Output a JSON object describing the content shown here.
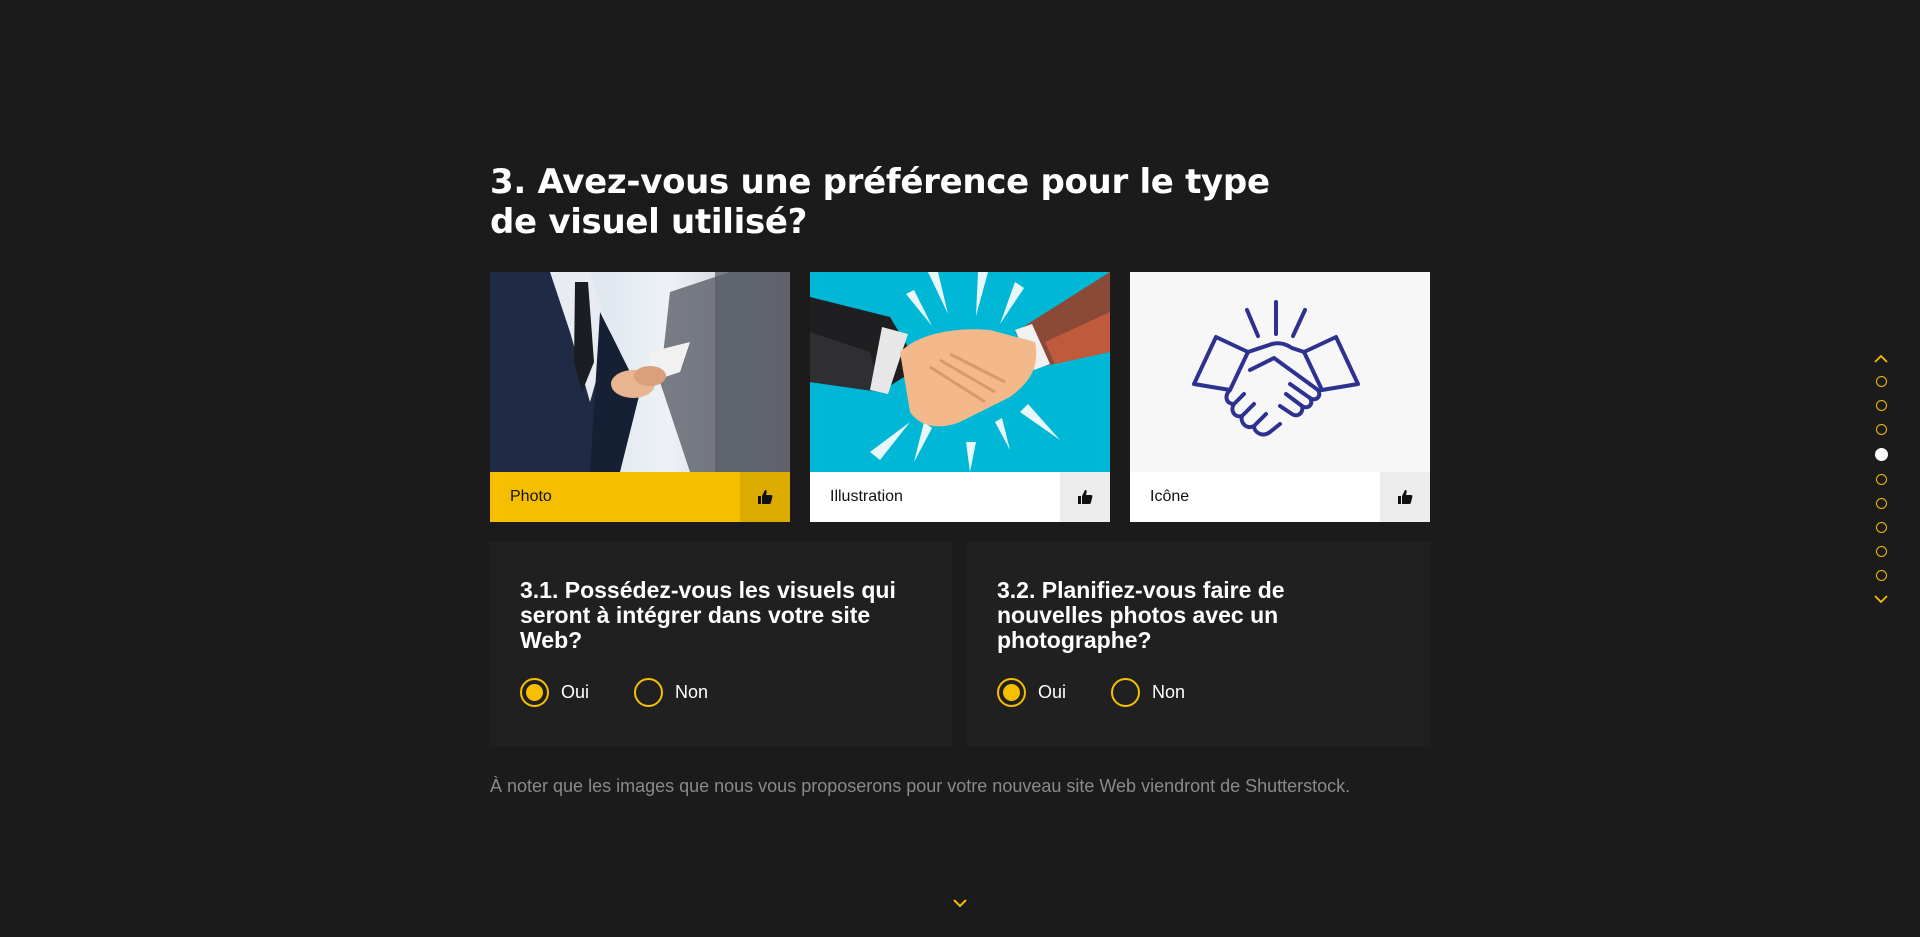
{
  "question": {
    "title": "3. Avez-vous une préférence pour le type de visuel utilisé?"
  },
  "visual_options": [
    {
      "label": "Photo",
      "selected": true
    },
    {
      "label": "Illustration",
      "selected": false
    },
    {
      "label": "Icône",
      "selected": false
    }
  ],
  "sub_questions": [
    {
      "title": "3.1. Possédez-vous les visuels qui seront à intégrer dans votre site Web?",
      "options": [
        {
          "label": "Oui",
          "checked": true
        },
        {
          "label": "Non",
          "checked": false
        }
      ]
    },
    {
      "title": "3.2. Planifiez-vous faire de nouvelles photos avec un photographe?",
      "options": [
        {
          "label": "Oui",
          "checked": true
        },
        {
          "label": "Non",
          "checked": false
        }
      ]
    }
  ],
  "note": "À noter que les images que nous vous proposerons pour votre nouveau site Web viendront de Shutterstock.",
  "pagination": {
    "total": 9,
    "current": 4
  },
  "colors": {
    "accent": "#f5bf00",
    "background": "#1b1b1b",
    "panel": "#202020",
    "icon_blue": "#2d3190",
    "illustration_bg": "#00b8d6"
  },
  "icons": {
    "like": "thumbs-up-icon",
    "next": "chevron-down-icon",
    "prev": "chevron-up-icon"
  }
}
